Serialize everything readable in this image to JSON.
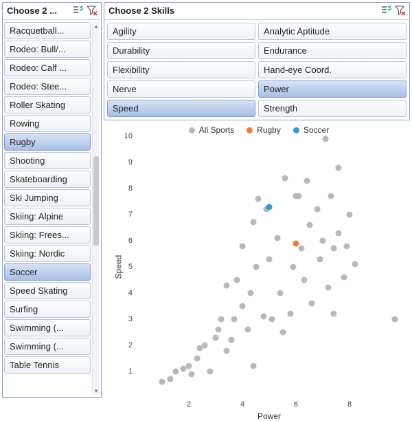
{
  "sidebar": {
    "title": "Choose 2 ...",
    "items": [
      {
        "label": "Racquetball...",
        "selected": false
      },
      {
        "label": "Rodeo: Bull/...",
        "selected": false
      },
      {
        "label": "Rodeo: Calf ...",
        "selected": false
      },
      {
        "label": "Rodeo: Stee...",
        "selected": false
      },
      {
        "label": "Roller Skating",
        "selected": false
      },
      {
        "label": "Rowing",
        "selected": false
      },
      {
        "label": "Rugby",
        "selected": true
      },
      {
        "label": "Shooting",
        "selected": false
      },
      {
        "label": "Skateboarding",
        "selected": false
      },
      {
        "label": "Ski Jumping",
        "selected": false
      },
      {
        "label": "Skiing: Alpine",
        "selected": false
      },
      {
        "label": "Skiing: Frees...",
        "selected": false
      },
      {
        "label": "Skiing: Nordic",
        "selected": false
      },
      {
        "label": "Soccer",
        "selected": true
      },
      {
        "label": "Speed Skating",
        "selected": false
      },
      {
        "label": "Surfing",
        "selected": false
      },
      {
        "label": "Swimming (...",
        "selected": false
      },
      {
        "label": "Swimming (...",
        "selected": false
      },
      {
        "label": "Table Tennis",
        "selected": false
      }
    ]
  },
  "skills": {
    "title": "Choose 2 Skills",
    "items": [
      {
        "label": "Agility",
        "selected": false
      },
      {
        "label": "Analytic Aptitude",
        "selected": false
      },
      {
        "label": "Durability",
        "selected": false
      },
      {
        "label": "Endurance",
        "selected": false
      },
      {
        "label": "Flexibility",
        "selected": false
      },
      {
        "label": "Hand-eye Coord.",
        "selected": false
      },
      {
        "label": "Nerve",
        "selected": false
      },
      {
        "label": "Power",
        "selected": true
      },
      {
        "label": "Speed",
        "selected": true
      },
      {
        "label": "Strength",
        "selected": false
      }
    ]
  },
  "chart_data": {
    "type": "scatter",
    "xlabel": "Power",
    "ylabel": "Speed",
    "xlim": [
      0,
      10
    ],
    "ylim": [
      0,
      10
    ],
    "xticks": [
      2,
      4,
      6,
      8
    ],
    "yticks": [
      1,
      2,
      3,
      4,
      5,
      6,
      7,
      8,
      9,
      10
    ],
    "legend": [
      {
        "name": "All Sports",
        "color": "#b8b8b8"
      },
      {
        "name": "Rugby",
        "color": "#ed7d31"
      },
      {
        "name": "Soccer",
        "color": "#2e9bd6"
      }
    ],
    "series": [
      {
        "name": "All Sports",
        "color": "#b8b8b8",
        "points": [
          [
            1.0,
            0.6
          ],
          [
            1.3,
            0.7
          ],
          [
            1.5,
            1.0
          ],
          [
            1.8,
            1.1
          ],
          [
            2.0,
            1.2
          ],
          [
            2.1,
            0.9
          ],
          [
            2.3,
            1.5
          ],
          [
            2.4,
            1.9
          ],
          [
            2.6,
            2.0
          ],
          [
            2.8,
            1.0
          ],
          [
            3.0,
            2.3
          ],
          [
            3.1,
            2.6
          ],
          [
            3.2,
            3.0
          ],
          [
            3.4,
            1.8
          ],
          [
            3.4,
            4.3
          ],
          [
            3.6,
            2.2
          ],
          [
            3.7,
            3.0
          ],
          [
            3.8,
            4.5
          ],
          [
            4.0,
            3.5
          ],
          [
            4.0,
            5.8
          ],
          [
            4.2,
            2.6
          ],
          [
            4.3,
            4.0
          ],
          [
            4.4,
            1.2
          ],
          [
            4.4,
            6.7
          ],
          [
            4.5,
            5.0
          ],
          [
            4.6,
            7.6
          ],
          [
            4.8,
            3.1
          ],
          [
            4.9,
            7.2
          ],
          [
            5.0,
            5.3
          ],
          [
            5.1,
            3.0
          ],
          [
            5.3,
            6.1
          ],
          [
            5.4,
            4.0
          ],
          [
            5.5,
            2.5
          ],
          [
            5.6,
            8.4
          ],
          [
            5.8,
            3.2
          ],
          [
            5.9,
            5.0
          ],
          [
            6.0,
            7.7
          ],
          [
            6.1,
            7.7
          ],
          [
            6.2,
            5.7
          ],
          [
            6.3,
            4.5
          ],
          [
            6.4,
            8.3
          ],
          [
            6.5,
            6.6
          ],
          [
            6.6,
            3.6
          ],
          [
            6.8,
            7.2
          ],
          [
            6.9,
            5.3
          ],
          [
            7.0,
            6.0
          ],
          [
            7.1,
            9.9
          ],
          [
            7.2,
            4.2
          ],
          [
            7.3,
            7.7
          ],
          [
            7.4,
            5.7
          ],
          [
            7.4,
            3.2
          ],
          [
            7.6,
            6.3
          ],
          [
            7.6,
            8.8
          ],
          [
            7.8,
            4.6
          ],
          [
            7.9,
            5.8
          ],
          [
            8.0,
            7.0
          ],
          [
            8.2,
            5.1
          ],
          [
            9.7,
            3.0
          ]
        ]
      },
      {
        "name": "Rugby",
        "color": "#ed7d31",
        "points": [
          [
            6.0,
            5.9
          ]
        ]
      },
      {
        "name": "Soccer",
        "color": "#2e9bd6",
        "points": [
          [
            5.0,
            7.3
          ]
        ]
      }
    ]
  }
}
